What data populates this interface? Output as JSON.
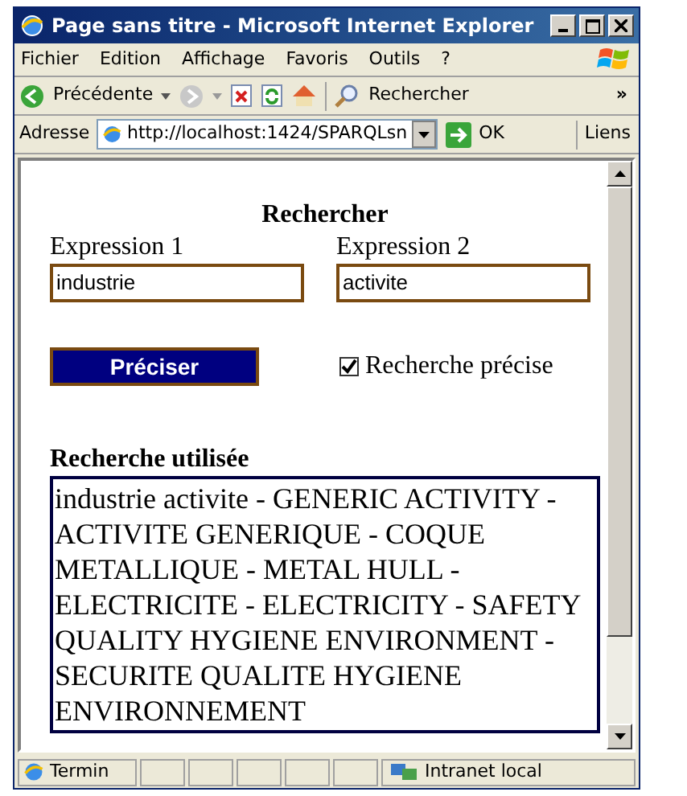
{
  "window": {
    "title": "Page sans titre - Microsoft Internet Explorer"
  },
  "menu": [
    "Fichier",
    "Edition",
    "Affichage",
    "Favoris",
    "Outils",
    "?"
  ],
  "toolbar": {
    "back": "Précédente",
    "search": "Rechercher",
    "more": "»"
  },
  "address": {
    "label": "Adresse",
    "value": "http://localhost:1424/SPARQLsn",
    "go": "OK",
    "links": "Liens"
  },
  "page": {
    "heading": "Rechercher",
    "fields": [
      {
        "label": "Expression 1",
        "value": "industrie"
      },
      {
        "label": "Expression 2",
        "value": "activite"
      }
    ],
    "button": "Préciser",
    "checkbox": {
      "label": "Recherche précise",
      "checked": true
    },
    "result_heading": "Recherche utilisée",
    "result": "industrie activite - GENERIC ACTIVITY - ACTIVITE GENERIQUE - COQUE METALLIQUE - METAL HULL - ELECTRICITE - ELECTRICITY - SAFETY QUALITY HYGIENE ENVIRONMENT - SECURITE QUALITE HYGIENE ENVIRONNEMENT"
  },
  "status_bar": {
    "status": "Termin",
    "zone": "Intranet local"
  }
}
